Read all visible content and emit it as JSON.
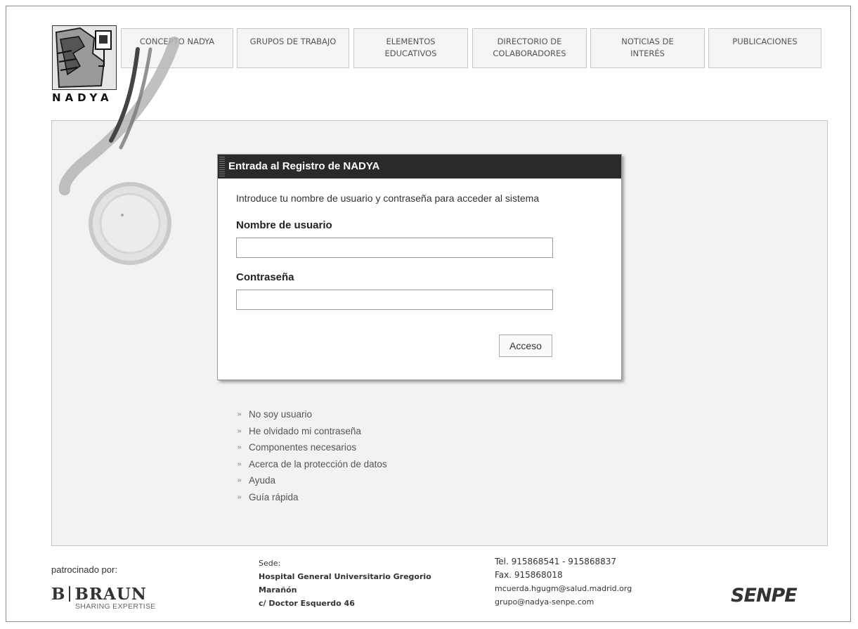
{
  "logo": {
    "text": "NADYA"
  },
  "nav": [
    {
      "label": "CONCEPTO NADYA"
    },
    {
      "label": "GRUPOS DE TRABAJO"
    },
    {
      "label": "ELEMENTOS EDUCATIVOS"
    },
    {
      "label": "DIRECTORIO DE COLABORADORES"
    },
    {
      "label": "NOTICIAS DE INTERÉS"
    },
    {
      "label": "PUBLICACIONES"
    }
  ],
  "login": {
    "title": "Entrada al Registro de NADYA",
    "intro": "Introduce tu nombre de usuario y contraseña para acceder al sistema",
    "username_label": "Nombre de usuario",
    "username_value": "",
    "password_label": "Contraseña",
    "password_value": "",
    "submit_label": "Acceso"
  },
  "links": [
    "No soy usuario",
    "He olvidado mi contraseña",
    "Componentes necesarios",
    "Acerca de la protección de datos",
    "Ayuda",
    "Guía rápida"
  ],
  "footer": {
    "sponsor_label": "patrocinado por:",
    "sponsor_brand": "BRAUN",
    "sponsor_brand_initial": "B",
    "sponsor_tagline": "SHARING EXPERTISE",
    "sede_title": "Sede:",
    "sede_line1": "Hospital General Universitario Gregorio",
    "sede_line2": "Marañón",
    "sede_line3": "c/ Doctor Esquerdo 46",
    "tel": "Tel. 915868541 - 915868837",
    "fax": "Fax. 915868018",
    "email1": "mcuerda.hgugm@salud.madrid.org",
    "email2": "grupo@nadya-senpe.com",
    "partner_logo": "SENPE"
  }
}
